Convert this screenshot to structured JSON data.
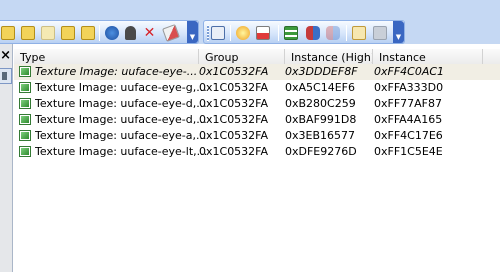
{
  "toolbar": {
    "icons": [
      "notes-icon",
      "notes-icon",
      "notes-faded-icon",
      "notes-icon",
      "notes-icon",
      "refresh-icon",
      "lock-icon",
      "delete-icon",
      "eraser-icon",
      "screen-icon",
      "star-icon",
      "red-flag-icon",
      "tree-icon",
      "users-icon",
      "users-faded-icon",
      "document-icon",
      "gray-box-icon"
    ],
    "accent": "#c5d8f3"
  },
  "left_pane": {
    "close_glyph": "×"
  },
  "list": {
    "columns": [
      "Type",
      "Group",
      "Instance (High)",
      "Instance"
    ],
    "rows": [
      {
        "type": "Texture Image: uuface-eye-...",
        "group": "0x1C0532FA",
        "instance_high": "0x3DDDEF8F",
        "instance": "0xFF4C0AC1",
        "selected": true
      },
      {
        "type": "Texture Image: uuface-eye-g,...",
        "group": "0x1C0532FA",
        "instance_high": "0xA5C14EF6",
        "instance": "0xFFA333D0",
        "selected": false
      },
      {
        "type": "Texture Image: uuface-eye-d,...",
        "group": "0x1C0532FA",
        "instance_high": "0xB280C259",
        "instance": "0xFF77AF87",
        "selected": false
      },
      {
        "type": "Texture Image: uuface-eye-d,...",
        "group": "0x1C0532FA",
        "instance_high": "0xBAF991D8",
        "instance": "0xFFA4A165",
        "selected": false
      },
      {
        "type": "Texture Image: uuface-eye-a,...",
        "group": "0x1C0532FA",
        "instance_high": "0x3EB16577",
        "instance": "0xFF4C17E6",
        "selected": false
      },
      {
        "type": "Texture Image: uuface-eye-lt,...",
        "group": "0x1C0532FA",
        "instance_high": "0xDFE9276D",
        "instance": "0xFF1C5E4E",
        "selected": false
      }
    ]
  }
}
